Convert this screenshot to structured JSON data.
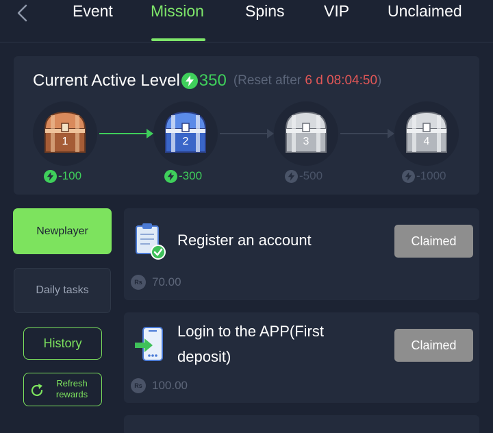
{
  "nav": {
    "tabs": [
      {
        "label": "Event"
      },
      {
        "label": "Mission"
      },
      {
        "label": "Spins"
      },
      {
        "label": "VIP"
      },
      {
        "label": "Unclaimed"
      }
    ],
    "active_tab": "Mission"
  },
  "level": {
    "title": "Current Active Level",
    "points": "350",
    "reset_prefix": "(Reset after ",
    "reset_time": "6 d 08:04:50",
    "reset_suffix": ")",
    "chests": [
      {
        "number": "1",
        "cost": "-100",
        "unlocked": true,
        "color": "#c8744a"
      },
      {
        "number": "2",
        "cost": "-300",
        "unlocked": true,
        "color": "#4f7fe0"
      },
      {
        "number": "3",
        "cost": "-500",
        "unlocked": false,
        "color": "#c9ccd2"
      },
      {
        "number": "4",
        "cost": "-1000",
        "unlocked": false,
        "color": "#c9ccd2"
      }
    ]
  },
  "sidebar": {
    "newplayer": "Newplayer",
    "daily_tasks": "Daily tasks",
    "history": "History",
    "refresh_line1": "Refresh",
    "refresh_line2": "rewards"
  },
  "tasks": [
    {
      "title": "Register an account",
      "button": "Claimed",
      "currency": "Rs",
      "reward": "70.00",
      "icon": "clipboard-check-icon"
    },
    {
      "title_line1": "Login to the APP(First",
      "title_line2": "deposit)",
      "button": "Claimed",
      "currency": "Rs",
      "reward": "100.00",
      "icon": "phone-login-icon"
    }
  ],
  "colors": {
    "background": "#1c2333",
    "panel": "#242c3d",
    "accent_green": "#7de35e",
    "bolt_green": "#3fcf5b",
    "timer_red": "#e25757",
    "claimed_gray": "#8e8e8e"
  }
}
